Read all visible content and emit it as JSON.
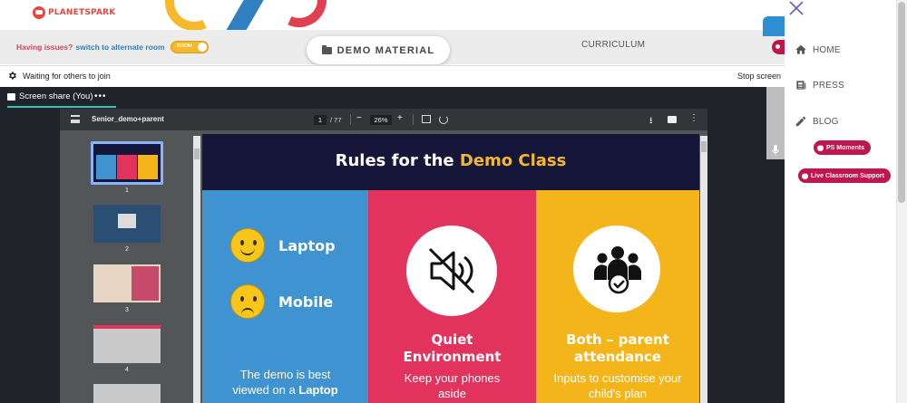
{
  "header": {
    "logo_text": "PLANETSPARK",
    "issues_text": "Having issues?",
    "switch_link": "switch to alternate room",
    "room_toggle_label": "ROOM",
    "demo_material_label": "DEMO MATERIAL",
    "curriculum_label": "CURRICULUM"
  },
  "status_bar": {
    "waiting_text": "Waiting for others to join",
    "stop_text": "Stop screen"
  },
  "screen_share": {
    "tab_label": "Screen share (You)",
    "more_label": "•••"
  },
  "pdf": {
    "title": "Senior_demo+parent",
    "current_page": "1",
    "total_pages": "/ 77",
    "zoom": "26%",
    "thumbnails": [
      {
        "num": "1",
        "bg": "#16163a"
      },
      {
        "num": "2",
        "bg": "#2b4f73"
      },
      {
        "num": "3",
        "bg": "#e8d6c4"
      },
      {
        "num": "4",
        "bg": "#c9c9c9"
      }
    ]
  },
  "slide": {
    "title_part1": "Rules for the ",
    "title_highlight": "Demo Class",
    "laptop_label": "Laptop",
    "mobile_label": "Mobile",
    "col1_body_1": "The demo is best",
    "col1_body_2": "viewed on a ",
    "col1_body_bold": "Laptop",
    "col2_title_1": "Quiet",
    "col2_title_2": "Environment",
    "col2_body_1": "Keep your phones",
    "col2_body_2": "aside",
    "col3_title_1": "Both – parent",
    "col3_title_2": "attendance",
    "col3_body_1": "Inputs to customise your",
    "col3_body_2": "child's plan",
    "colors": {
      "col1": "#3f93d1",
      "col2": "#e2335e",
      "col3": "#f3b51a",
      "header": "#16163a",
      "highlight": "#f5b829"
    }
  },
  "right_nav": {
    "items": [
      {
        "label": "HOME",
        "icon": "home-icon"
      },
      {
        "label": "PRESS",
        "icon": "newspaper-icon"
      },
      {
        "label": "BLOG",
        "icon": "pencil-icon"
      }
    ],
    "ps_moments": "PS Moments",
    "live_support": "Live Classroom Support"
  }
}
